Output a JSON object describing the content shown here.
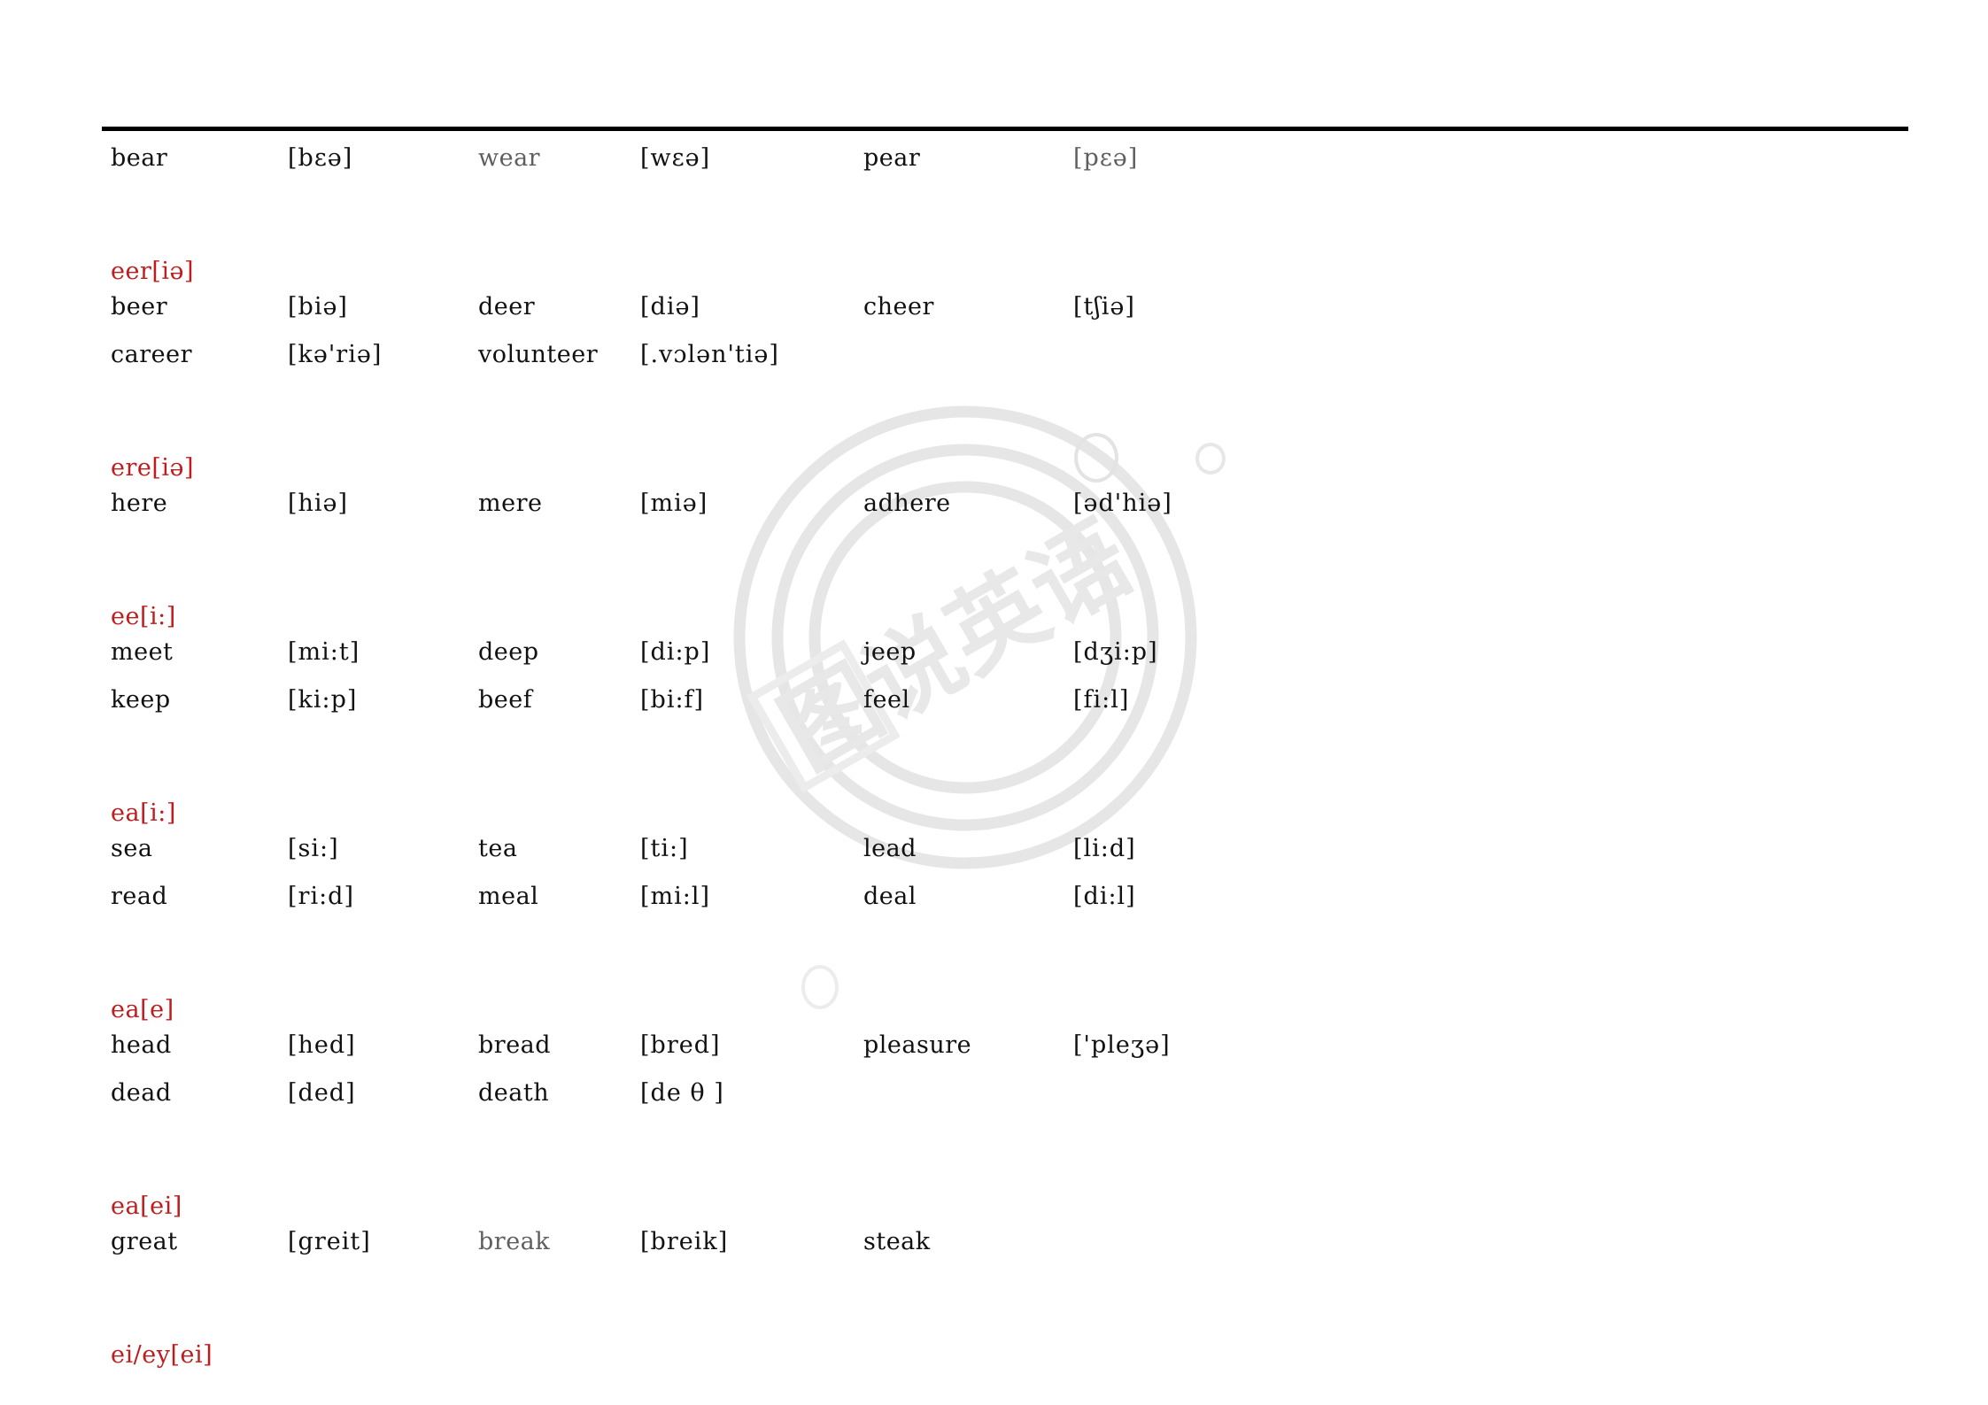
{
  "document": {
    "title": "English Vowel Combination Pronunciation Chart",
    "watermark_text": "图说英语",
    "accent_color": "#bf1d1d",
    "text_color": "#111111",
    "dim_text_color": "#5f5f5f",
    "rule_color": "#000000"
  },
  "orphan_row": {
    "cells": [
      {
        "text": "bear",
        "dim": false
      },
      {
        "text": "[bɛə]",
        "dim": false
      },
      {
        "text": "wear",
        "dim": true
      },
      {
        "text": "[wɛə]",
        "dim": false
      },
      {
        "text": "pear",
        "dim": false
      },
      {
        "text": "[pɛə]",
        "dim": true
      }
    ]
  },
  "sections": [
    {
      "heading": "eer[iə]",
      "rows": [
        [
          {
            "text": "beer",
            "dim": false
          },
          {
            "text": "[biə]",
            "dim": false
          },
          {
            "text": "deer",
            "dim": false
          },
          {
            "text": "[diə]",
            "dim": false
          },
          {
            "text": "cheer",
            "dim": false
          },
          {
            "text": "[tʃiə]",
            "dim": false
          }
        ],
        [
          {
            "text": "career",
            "dim": false
          },
          {
            "text": "[kə'riə]",
            "dim": false
          },
          {
            "text": "volunteer",
            "dim": false
          },
          {
            "text": "[.vɔlən'tiə]",
            "dim": false
          },
          {
            "text": "",
            "dim": false
          },
          {
            "text": "",
            "dim": false
          }
        ]
      ]
    },
    {
      "heading": "ere[iə]",
      "rows": [
        [
          {
            "text": "here",
            "dim": false
          },
          {
            "text": "[hiə]",
            "dim": false
          },
          {
            "text": "mere",
            "dim": false
          },
          {
            "text": "[miə]",
            "dim": false
          },
          {
            "text": "adhere",
            "dim": false
          },
          {
            "text": "[əd'hiə]",
            "dim": false
          }
        ]
      ]
    },
    {
      "heading": "ee[i:]",
      "rows": [
        [
          {
            "text": "meet",
            "dim": false
          },
          {
            "text": "[mi:t]",
            "dim": false
          },
          {
            "text": "deep",
            "dim": false
          },
          {
            "text": "[di:p]",
            "dim": false
          },
          {
            "text": "jeep",
            "dim": false
          },
          {
            "text": "[dʒi:p]",
            "dim": false
          }
        ],
        [
          {
            "text": "keep",
            "dim": false
          },
          {
            "text": "[ki:p]",
            "dim": false
          },
          {
            "text": "beef",
            "dim": false
          },
          {
            "text": "[bi:f]",
            "dim": false
          },
          {
            "text": "feel",
            "dim": false
          },
          {
            "text": "[fi:l]",
            "dim": false
          }
        ]
      ]
    },
    {
      "heading": "ea[i:]",
      "rows": [
        [
          {
            "text": "sea",
            "dim": false
          },
          {
            "text": "[si:]",
            "dim": false
          },
          {
            "text": "tea",
            "dim": false
          },
          {
            "text": "[ti:]",
            "dim": false
          },
          {
            "text": "lead",
            "dim": false
          },
          {
            "text": "[li:d]",
            "dim": false
          }
        ],
        [
          {
            "text": "read",
            "dim": false
          },
          {
            "text": "[ri:d]",
            "dim": false
          },
          {
            "text": "meal",
            "dim": false
          },
          {
            "text": "[mi:l]",
            "dim": false
          },
          {
            "text": "deal",
            "dim": false
          },
          {
            "text": "[di:l]",
            "dim": false
          }
        ]
      ]
    },
    {
      "heading": "ea[e]",
      "rows": [
        [
          {
            "text": "head",
            "dim": false
          },
          {
            "text": "[hed]",
            "dim": false
          },
          {
            "text": "bread",
            "dim": false
          },
          {
            "text": "[bred]",
            "dim": false
          },
          {
            "text": "pleasure",
            "dim": false
          },
          {
            "text": "['pleʒə]",
            "dim": false
          }
        ],
        [
          {
            "text": "dead",
            "dim": false
          },
          {
            "text": "[ded]",
            "dim": false
          },
          {
            "text": "death",
            "dim": false
          },
          {
            "text": "[de θ ]",
            "dim": false
          },
          {
            "text": "",
            "dim": false
          },
          {
            "text": "",
            "dim": false
          }
        ]
      ]
    },
    {
      "heading": "ea[ei]",
      "rows": [
        [
          {
            "text": "great",
            "dim": false
          },
          {
            "text": "[greit]",
            "dim": false
          },
          {
            "text": "break",
            "dim": true
          },
          {
            "text": "[breik]",
            "dim": false
          },
          {
            "text": "steak",
            "dim": false
          },
          {
            "text": "",
            "dim": false
          }
        ]
      ]
    },
    {
      "heading": "ei/ey[ei]",
      "rows": []
    }
  ]
}
